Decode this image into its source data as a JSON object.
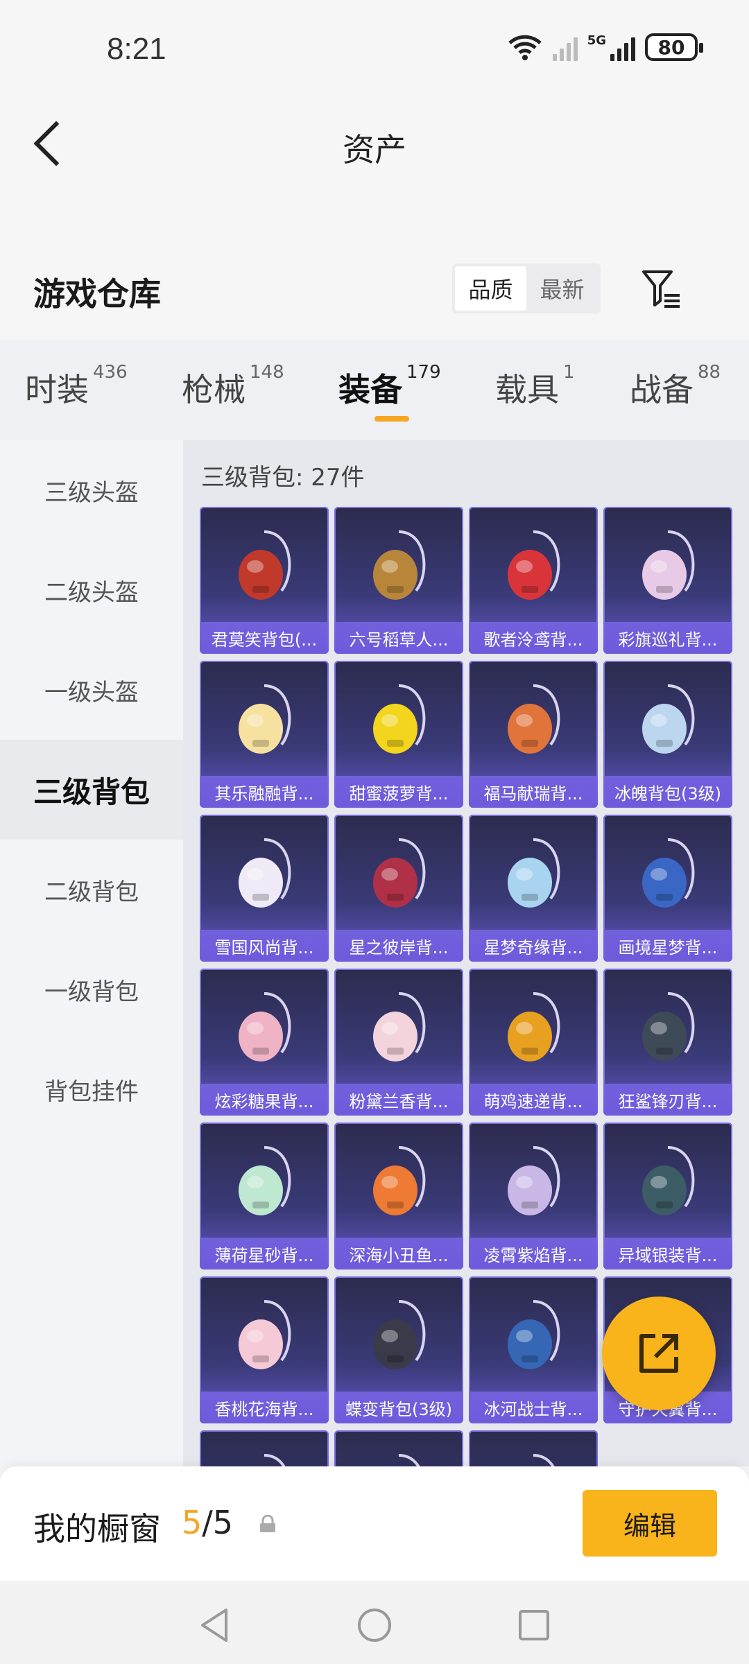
{
  "status_bar": {
    "time": "8:21",
    "network": "5G",
    "battery": "80"
  },
  "header": {
    "title": "资产"
  },
  "warehouse": {
    "title": "游戏仓库",
    "sort": {
      "options": [
        "品质",
        "最新"
      ],
      "selected": "品质"
    }
  },
  "tabs": [
    {
      "label": "时装",
      "count": "436"
    },
    {
      "label": "枪械",
      "count": "148"
    },
    {
      "label": "装备",
      "count": "179",
      "active": true
    },
    {
      "label": "载具",
      "count": "1"
    },
    {
      "label": "战备",
      "count": "88"
    }
  ],
  "sidebar": {
    "items": [
      {
        "label": "三级头盔"
      },
      {
        "label": "二级头盔"
      },
      {
        "label": "一级头盔"
      },
      {
        "label": "三级背包",
        "active": true
      },
      {
        "label": "二级背包"
      },
      {
        "label": "一级背包"
      },
      {
        "label": "背包挂件"
      }
    ]
  },
  "content": {
    "count_label": "三级背包: 27件",
    "items": [
      {
        "name": "君莫笑背包(...",
        "color": "#c0392b"
      },
      {
        "name": "六号稻草人...",
        "color": "#b8863b"
      },
      {
        "name": "歌者泠鸢背...",
        "color": "#d9343a"
      },
      {
        "name": "彩旗巡礼背...",
        "color": "#e8c9e6"
      },
      {
        "name": "其乐融融背...",
        "color": "#f6e1a0"
      },
      {
        "name": "甜蜜菠萝背...",
        "color": "#f2d51c"
      },
      {
        "name": "福马献瑞背...",
        "color": "#e0743b"
      },
      {
        "name": "冰魄背包(3级)",
        "color": "#bcd6ef"
      },
      {
        "name": "雪国风尚背...",
        "color": "#efeaf5"
      },
      {
        "name": "星之彼岸背...",
        "color": "#b03048"
      },
      {
        "name": "星梦奇缘背...",
        "color": "#a8d4f0"
      },
      {
        "name": "画境星梦背...",
        "color": "#3a66c4"
      },
      {
        "name": "炫彩糖果背...",
        "color": "#f0b3c6"
      },
      {
        "name": "粉黛兰香背...",
        "color": "#f3d4dc"
      },
      {
        "name": "萌鸡速递背...",
        "color": "#e8a021"
      },
      {
        "name": "狂鲨锋刃背...",
        "color": "#3f4a58"
      },
      {
        "name": "薄荷星砂背...",
        "color": "#bfe8d0"
      },
      {
        "name": "深海小丑鱼...",
        "color": "#ee7a34"
      },
      {
        "name": "凌霄紫焰背...",
        "color": "#c9b8e6"
      },
      {
        "name": "异域银装背...",
        "color": "#3c5c66"
      },
      {
        "name": "香桃花海背...",
        "color": "#f5c9d5"
      },
      {
        "name": "蝶变背包(3级)",
        "color": "#3a3a4a"
      },
      {
        "name": "冰河战士背...",
        "color": "#3567b5"
      },
      {
        "name": "守护天翼背...",
        "color": "#8899aa"
      },
      {
        "name": "",
        "color": "#9a9a60"
      },
      {
        "name": "",
        "color": "#333333"
      },
      {
        "name": "",
        "color": "#d8c7a0"
      }
    ]
  },
  "showcase": {
    "label": "我的橱窗",
    "current": "5",
    "separator": "/",
    "total": "5",
    "edit_label": "编辑"
  },
  "colors": {
    "accent": "#f9b31b",
    "card_bg": "#3a3a78",
    "card_label": "#7a66e0"
  }
}
